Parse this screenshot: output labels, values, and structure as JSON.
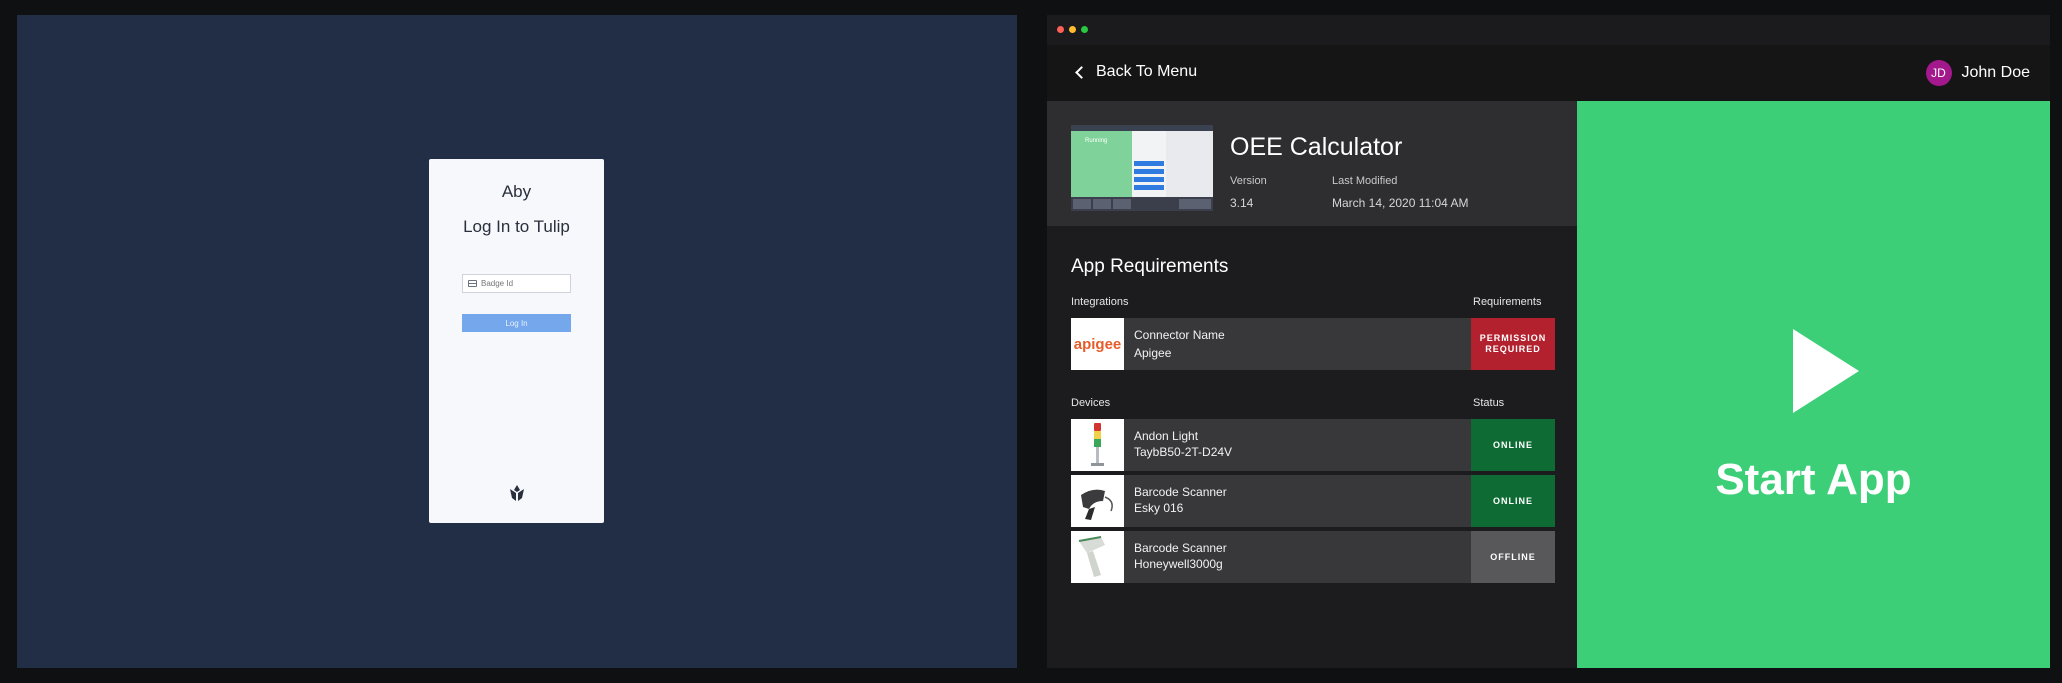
{
  "login": {
    "user_name": "Aby",
    "title": "Log In to Tulip",
    "badge_placeholder": "Badge Id",
    "login_button": "Log In"
  },
  "window": {
    "traffic_colors": [
      "#fe5f57",
      "#febc2e",
      "#28c840"
    ]
  },
  "topbar": {
    "back_label": "Back To Menu",
    "user_initials": "JD",
    "user_name": "John Doe",
    "avatar_color": "#a3188d"
  },
  "app": {
    "title": "OEE Calculator",
    "version_label": "Version",
    "version_value": "3.14",
    "modified_label": "Last Modified",
    "modified_value": "March 14, 2020 11:04 AM",
    "thumbnail_state": "Running"
  },
  "requirements": {
    "title": "App Requirements",
    "integrations_header": "Integrations",
    "requirements_header": "Requirements",
    "integrations": [
      {
        "logo": "apigee",
        "line1": "Connector Name",
        "line2": "Apigee",
        "status": "PERMISSION REQUIRED",
        "status_color": "#b3212f"
      }
    ],
    "devices_header": "Devices",
    "status_header": "Status",
    "devices": [
      {
        "icon": "andon-light-icon",
        "line1": "Andon Light",
        "line2": "TaybB50-2T-D24V",
        "status": "ONLINE",
        "status_color": "#0f6b34"
      },
      {
        "icon": "barcode-scanner-icon",
        "line1": "Barcode Scanner",
        "line2": "Esky 016",
        "status": "ONLINE",
        "status_color": "#0f6b34"
      },
      {
        "icon": "barcode-scanner-icon",
        "line1": "Barcode Scanner",
        "line2": "Honeywell3000g",
        "status": "OFFLINE",
        "status_color": "#58585a"
      }
    ]
  },
  "start": {
    "label": "Start App",
    "color": "#3ccf78"
  }
}
